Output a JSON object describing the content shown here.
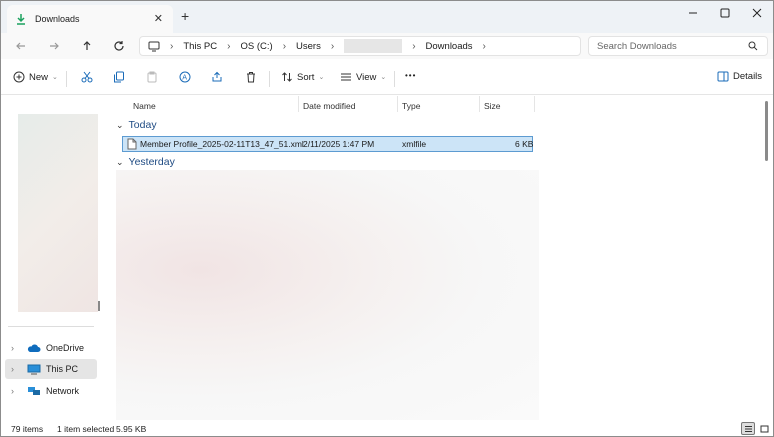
{
  "window": {
    "tab_title": "Downloads",
    "close_tab_glyph": "✕",
    "new_tab_glyph": "+"
  },
  "address": {
    "crumbs": [
      "This PC",
      "OS (C:)",
      "Users",
      "Downloads"
    ],
    "search_placeholder": "Search Downloads"
  },
  "toolbar": {
    "new_label": "New",
    "sort_label": "Sort",
    "view_label": "View",
    "more_label": "•••",
    "details_label": "Details"
  },
  "sidebar": {
    "items": [
      {
        "label": "OneDrive",
        "icon": "onedrive-icon"
      },
      {
        "label": "This PC",
        "icon": "computer-icon"
      },
      {
        "label": "Network",
        "icon": "network-icon"
      }
    ]
  },
  "columns": [
    "Name",
    "Date modified",
    "Type",
    "Size"
  ],
  "groups": [
    "Today",
    "Yesterday"
  ],
  "files": [
    {
      "name": "Member Profile_2025-02-11T13_47_51.xml",
      "date": "2/11/2025 1:47 PM",
      "type": "xmlfile",
      "size": "6 KB"
    }
  ],
  "status": {
    "count": "79 items",
    "selected": "1 item selected",
    "selected_size": "5.95 KB"
  },
  "colors": {
    "accent": "#1f4b83",
    "selection": "#cce4f7",
    "download_green": "#1aa15e"
  }
}
